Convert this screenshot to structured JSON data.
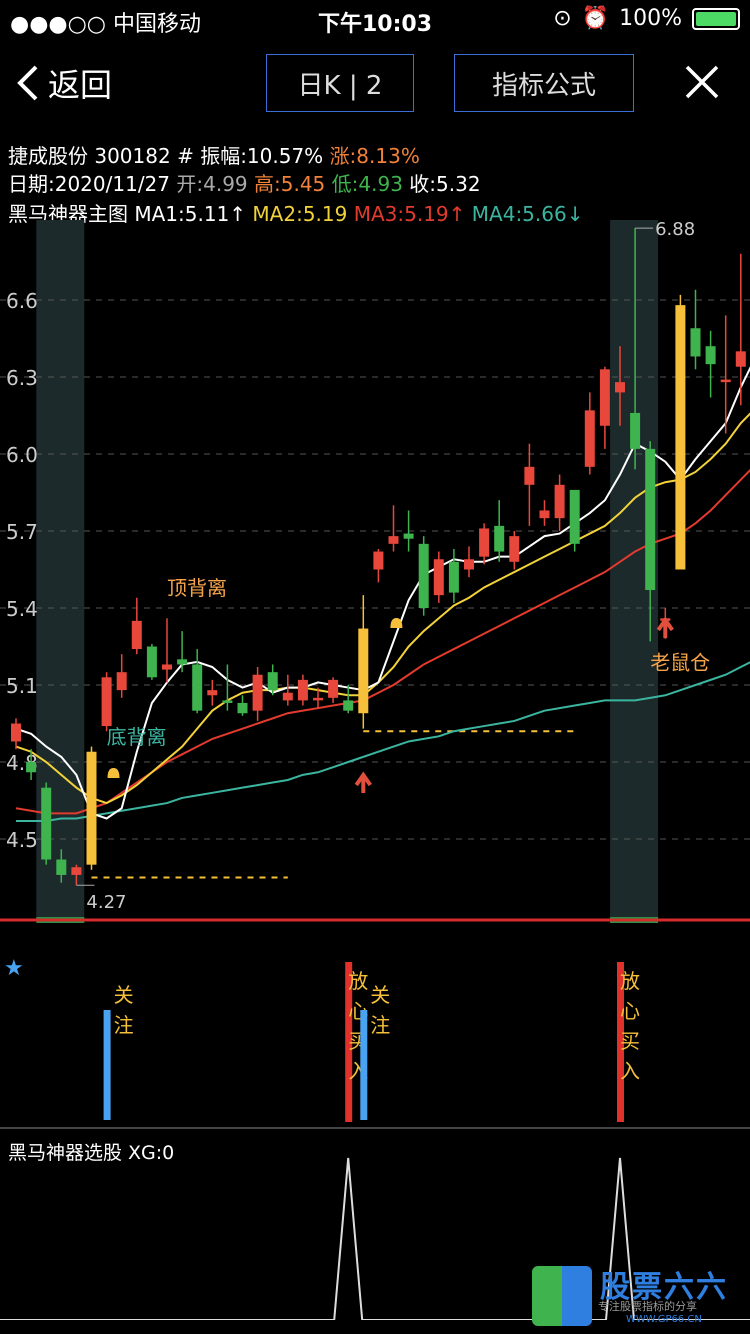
{
  "status": {
    "carrier": "●●●○○ 中国移动",
    "time": "下午10:03",
    "battery": "100%"
  },
  "nav": {
    "back": "返回",
    "tab1": "日K | 2",
    "tab2": "指标公式"
  },
  "info": {
    "line1_name": "捷成股份 300182",
    "line1_amp": "# 振幅:10.57%",
    "line1_rise": "涨:8.13%",
    "line2_date": "日期:2020/11/27",
    "line2_open": "开:4.99",
    "line2_high": "高:5.45",
    "line2_low": "低:4.93",
    "line2_close": "收:5.32",
    "line3_title": "黑马神器主图",
    "ma1": "MA1:5.11↑",
    "ma2": "MA2:5.19",
    "ma3": "MA3:5.19↑",
    "ma4": "MA4:5.66↓"
  },
  "colors": {
    "up": "#e8473c",
    "down": "#3fb44e",
    "ma1": "#ffffff",
    "ma2": "#f2d23a",
    "ma3": "#e23b2e",
    "ma4": "#3bb5a0",
    "highlight": "#f6c03a",
    "blue": "#4aa3f0",
    "red": "#e0322a"
  },
  "chart_data": {
    "type": "candlestick",
    "yticks": [
      4.5,
      4.8,
      5.1,
      5.4,
      5.7,
      6.0,
      6.3,
      6.6
    ],
    "ytick_labels": [
      "4.5",
      "4.8",
      "5.1",
      "5.4",
      "5.7",
      "6.0",
      "6.3",
      "6.6"
    ],
    "ylim": [
      4.27,
      6.88
    ],
    "max_label": "6.88",
    "min_label": "4.27",
    "candles": [
      [
        4.88,
        4.97,
        4.85,
        4.95
      ],
      [
        4.8,
        4.85,
        4.73,
        4.76
      ],
      [
        4.7,
        4.72,
        4.4,
        4.42
      ],
      [
        4.42,
        4.46,
        4.33,
        4.36
      ],
      [
        4.36,
        4.4,
        4.32,
        4.39
      ],
      [
        4.4,
        4.86,
        4.38,
        4.84
      ],
      [
        4.94,
        5.15,
        4.92,
        5.13
      ],
      [
        5.08,
        5.22,
        5.05,
        5.15
      ],
      [
        5.24,
        5.44,
        5.22,
        5.35
      ],
      [
        5.25,
        5.26,
        5.12,
        5.13
      ],
      [
        5.16,
        5.36,
        5.11,
        5.18
      ],
      [
        5.2,
        5.31,
        5.15,
        5.18
      ],
      [
        5.18,
        5.24,
        4.99,
        5.0
      ],
      [
        5.06,
        5.12,
        5.02,
        5.08
      ],
      [
        5.04,
        5.18,
        5.0,
        5.03
      ],
      [
        5.03,
        5.06,
        4.98,
        4.99
      ],
      [
        5.0,
        5.17,
        4.96,
        5.14
      ],
      [
        5.15,
        5.18,
        5.06,
        5.08
      ],
      [
        5.04,
        5.14,
        5.02,
        5.07
      ],
      [
        5.04,
        5.14,
        5.02,
        5.12
      ],
      [
        5.04,
        5.09,
        5.01,
        5.05
      ],
      [
        5.05,
        5.13,
        5.03,
        5.12
      ],
      [
        5.04,
        5.1,
        4.99,
        5.0
      ],
      [
        4.99,
        5.45,
        4.93,
        5.32
      ],
      [
        5.55,
        5.63,
        5.5,
        5.62
      ],
      [
        5.65,
        5.8,
        5.62,
        5.68
      ],
      [
        5.69,
        5.78,
        5.62,
        5.67
      ],
      [
        5.65,
        5.68,
        5.37,
        5.4
      ],
      [
        5.45,
        5.62,
        5.42,
        5.59
      ],
      [
        5.58,
        5.63,
        5.42,
        5.46
      ],
      [
        5.55,
        5.64,
        5.52,
        5.59
      ],
      [
        5.6,
        5.73,
        5.57,
        5.71
      ],
      [
        5.72,
        5.82,
        5.58,
        5.62
      ],
      [
        5.58,
        5.7,
        5.55,
        5.68
      ],
      [
        5.88,
        6.04,
        5.72,
        5.95
      ],
      [
        5.75,
        5.82,
        5.72,
        5.78
      ],
      [
        5.75,
        5.92,
        5.7,
        5.88
      ],
      [
        5.86,
        5.86,
        5.62,
        5.65
      ],
      [
        5.95,
        6.24,
        5.92,
        6.17
      ],
      [
        6.11,
        6.34,
        6.02,
        6.33
      ],
      [
        6.24,
        6.42,
        6.11,
        6.28
      ],
      [
        6.16,
        6.88,
        5.94,
        6.02
      ],
      [
        6.02,
        6.05,
        5.27,
        5.47
      ],
      [
        5.35,
        5.4,
        5.28,
        5.36
      ],
      [
        5.55,
        6.62,
        5.55,
        6.58
      ],
      [
        6.49,
        6.64,
        6.33,
        6.38
      ],
      [
        6.42,
        6.48,
        6.22,
        6.35
      ],
      [
        6.28,
        6.54,
        6.08,
        6.29
      ],
      [
        6.34,
        6.78,
        6.19,
        6.4
      ],
      [
        6.35,
        6.64,
        6.32,
        6.53
      ]
    ],
    "ma1": [
      4.93,
      4.91,
      4.86,
      4.82,
      4.75,
      4.6,
      4.58,
      4.62,
      4.84,
      5.03,
      5.11,
      5.18,
      5.19,
      5.17,
      5.12,
      5.09,
      5.11,
      5.07,
      5.09,
      5.09,
      5.11,
      5.1,
      5.09,
      5.08,
      5.11,
      5.27,
      5.43,
      5.53,
      5.56,
      5.59,
      5.58,
      5.58,
      5.6,
      5.6,
      5.64,
      5.68,
      5.69,
      5.73,
      5.77,
      5.82,
      5.92,
      6.04,
      6.01,
      5.97,
      5.9,
      5.98,
      6.05,
      6.12,
      6.26,
      6.38
    ],
    "ma2": [
      4.86,
      4.84,
      4.8,
      4.75,
      4.7,
      4.66,
      4.64,
      4.67,
      4.71,
      4.76,
      4.81,
      4.86,
      4.93,
      5.0,
      5.04,
      5.07,
      5.08,
      5.08,
      5.09,
      5.09,
      5.08,
      5.07,
      5.06,
      5.06,
      5.11,
      5.17,
      5.25,
      5.31,
      5.36,
      5.41,
      5.44,
      5.48,
      5.51,
      5.54,
      5.57,
      5.6,
      5.63,
      5.66,
      5.69,
      5.72,
      5.77,
      5.83,
      5.87,
      5.89,
      5.9,
      5.93,
      5.98,
      6.04,
      6.12,
      6.18
    ],
    "ma3": [
      4.62,
      4.61,
      4.6,
      4.6,
      4.6,
      4.62,
      4.64,
      4.68,
      4.72,
      4.76,
      4.8,
      4.83,
      4.86,
      4.89,
      4.91,
      4.93,
      4.95,
      4.97,
      4.99,
      5.0,
      5.01,
      5.02,
      5.03,
      5.04,
      5.07,
      5.1,
      5.14,
      5.18,
      5.21,
      5.24,
      5.27,
      5.3,
      5.33,
      5.36,
      5.39,
      5.42,
      5.45,
      5.48,
      5.51,
      5.54,
      5.58,
      5.62,
      5.65,
      5.67,
      5.69,
      5.73,
      5.78,
      5.84,
      5.9,
      5.96
    ],
    "ma4": [
      4.57,
      4.57,
      4.57,
      4.58,
      4.58,
      4.59,
      4.6,
      4.61,
      4.62,
      4.63,
      4.64,
      4.66,
      4.67,
      4.68,
      4.69,
      4.7,
      4.71,
      4.72,
      4.73,
      4.75,
      4.76,
      4.78,
      4.8,
      4.82,
      4.84,
      4.86,
      4.88,
      4.89,
      4.9,
      4.92,
      4.93,
      4.94,
      4.95,
      4.96,
      4.98,
      5.0,
      5.01,
      5.02,
      5.03,
      5.04,
      5.04,
      5.04,
      5.05,
      5.06,
      5.08,
      5.1,
      5.12,
      5.14,
      5.17,
      5.2
    ],
    "highlight_bars": [
      5,
      23,
      44
    ],
    "shade_columns": [
      3,
      41
    ],
    "support_lines": [
      {
        "start": 5,
        "end": 18,
        "value": 4.35
      },
      {
        "start": 23,
        "end": 37,
        "value": 4.92
      }
    ],
    "annotations": [
      {
        "text": "顶背离",
        "index": 10,
        "value": 5.45,
        "color": "#f6a34a"
      },
      {
        "text": "底背离",
        "index": 6,
        "value": 4.87,
        "color": "#3bb5a0"
      },
      {
        "text": "老鼠仓",
        "index": 42,
        "value": 5.16,
        "color": "#f6a34a"
      }
    ],
    "arrows": [
      23,
      43
    ],
    "bells": [
      5,
      24
    ],
    "signals_label": "★",
    "signals": [
      {
        "index": 6,
        "color": "#4aa3f0",
        "chars": [
          "关",
          "注"
        ],
        "height": 110,
        "textcolor": "#f6c03a"
      },
      {
        "index": 22,
        "color": "#e0322a",
        "chars": [
          "放",
          "心",
          "买",
          "入"
        ],
        "height": 160,
        "textcolor": "#f6c03a"
      },
      {
        "index": 23,
        "color": "#4aa3f0",
        "chars": [
          "关",
          "注"
        ],
        "height": 110,
        "textcolor": "#f6c03a"
      },
      {
        "index": 40,
        "color": "#e0322a",
        "chars": [
          "放",
          "心",
          "买",
          "入"
        ],
        "height": 160,
        "textcolor": "#f6c03a"
      }
    ],
    "xg_label": "黑马神器选股 XG:0",
    "xg_spikes": [
      22,
      40
    ]
  },
  "watermark": {
    "line1": "股票六六",
    "line2": "专注股票指标的分享",
    "url": "WWW.GP66.CN"
  }
}
